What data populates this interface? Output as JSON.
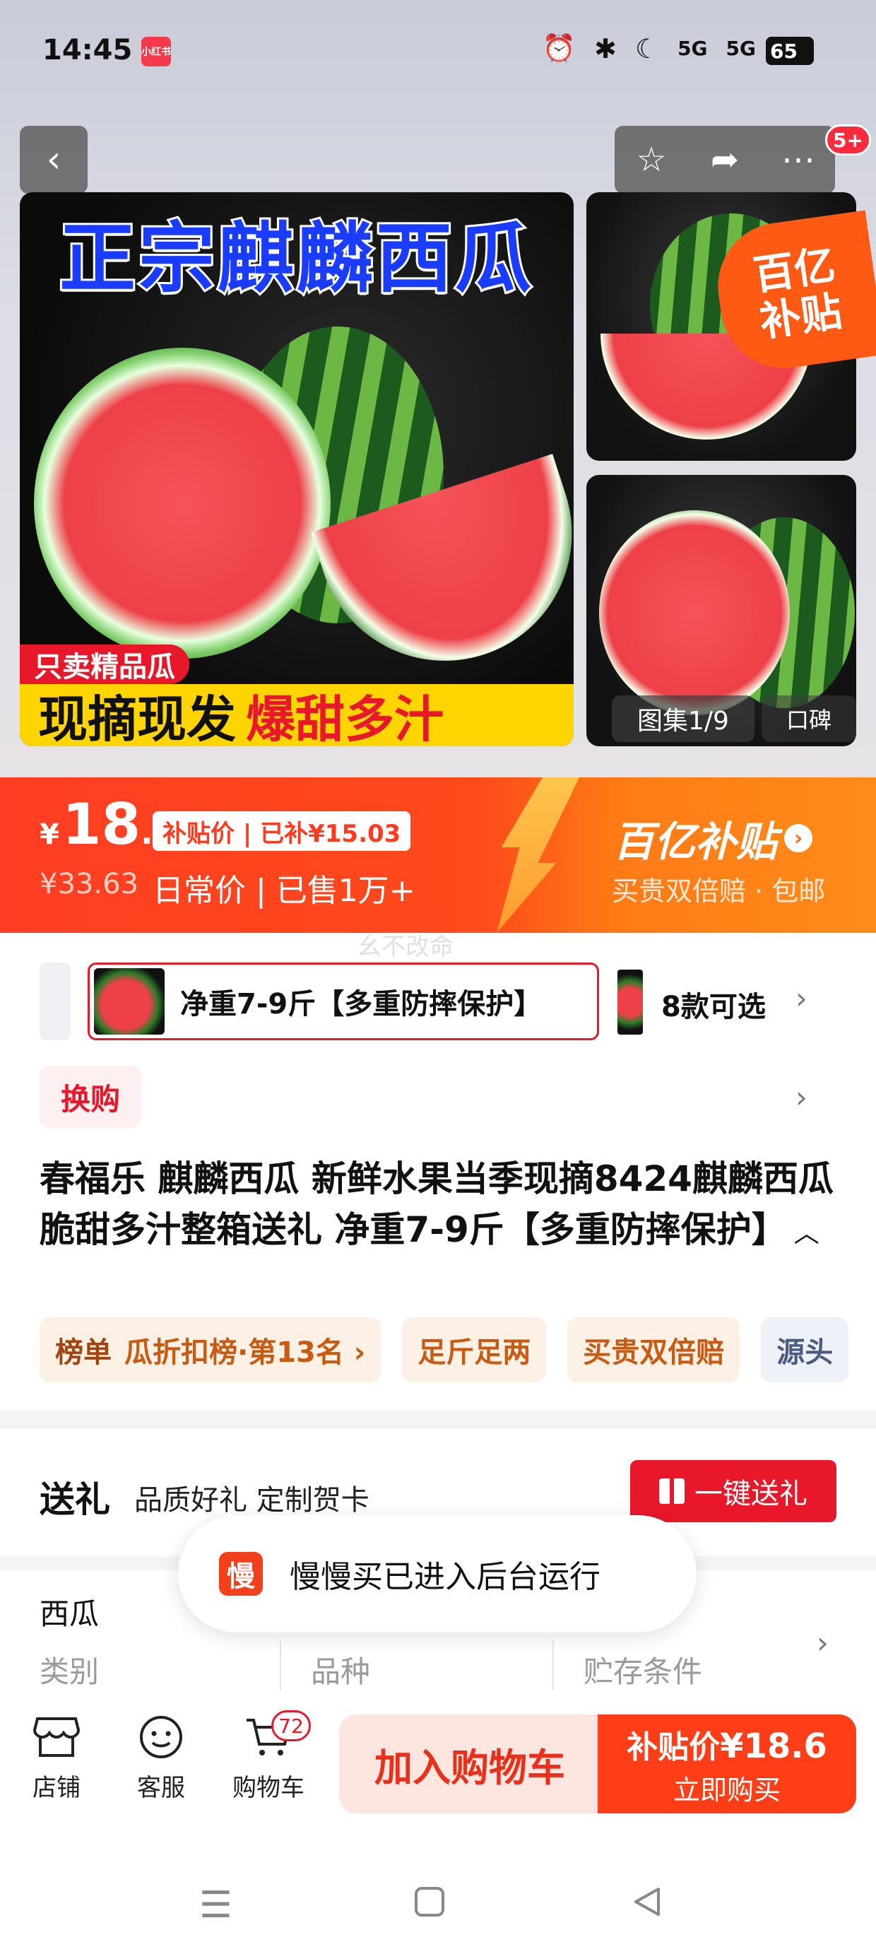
{
  "status_bar": {
    "time": "14:45",
    "app_badge": "小红书",
    "signal_1": "5G",
    "signal_2": "5G",
    "battery": "65"
  },
  "gallery": {
    "message_count": "5+",
    "main_title": "正宗麒麟西瓜",
    "tag_red": "只卖精品瓜",
    "caption_part1": "现摘现发",
    "caption_part2": "爆甜多汁",
    "subsidy_line1": "百亿",
    "subsidy_line2": "补贴",
    "counter": "图集1/9",
    "alt_label": "口碑"
  },
  "price": {
    "currency": "¥",
    "integer": "18",
    "decimal": ".6",
    "label": "补贴价 | 已补¥15.03",
    "original": "¥33.63",
    "meta": "日常价 | 已售1万+",
    "program_name": "百亿补贴",
    "program_sub": "买贵双倍赔 · 包邮"
  },
  "watermark": "幺不改命",
  "sku": {
    "selected": "净重7-9斤【多重防摔保护】",
    "more": "8款可选"
  },
  "exchange": "换购",
  "product": {
    "title": "春福乐 麒麟西瓜 新鲜水果当季现摘8424麒麟西瓜脆甜多汁整箱送礼 净重7-9斤【多重防摔保护】"
  },
  "tags": {
    "rank_label": "榜单",
    "rank_text": "瓜折扣榜·第13名 ›",
    "tag2": "足斤足两",
    "tag3": "买贵双倍赔",
    "tag4": "源头"
  },
  "gift": {
    "title": "送礼",
    "desc": "品质好礼 定制贺卡",
    "button": "一键送礼"
  },
  "attributes": {
    "value_1": "西瓜",
    "labels": [
      "类别",
      "品种",
      "贮存条件"
    ]
  },
  "toast": {
    "icon": "慢",
    "text": "慢慢买已进入后台运行"
  },
  "bottom_bar": {
    "shop": "店铺",
    "service": "客服",
    "cart": "购物车",
    "cart_count": "72",
    "add_cart": "加入购物车",
    "buy_price_label": "补贴价",
    "buy_price": "¥18.6",
    "buy_label": "立即购买"
  },
  "icons": {
    "back": "chevron-left-icon",
    "favorite": "star-icon",
    "share": "share-icon",
    "more": "more-icon"
  },
  "colors": {
    "accent_red": "#e8182a",
    "banner_orange": "#ff4a1a",
    "buy_button": "#ff3d16",
    "add_cart_bg": "#fde6df"
  }
}
